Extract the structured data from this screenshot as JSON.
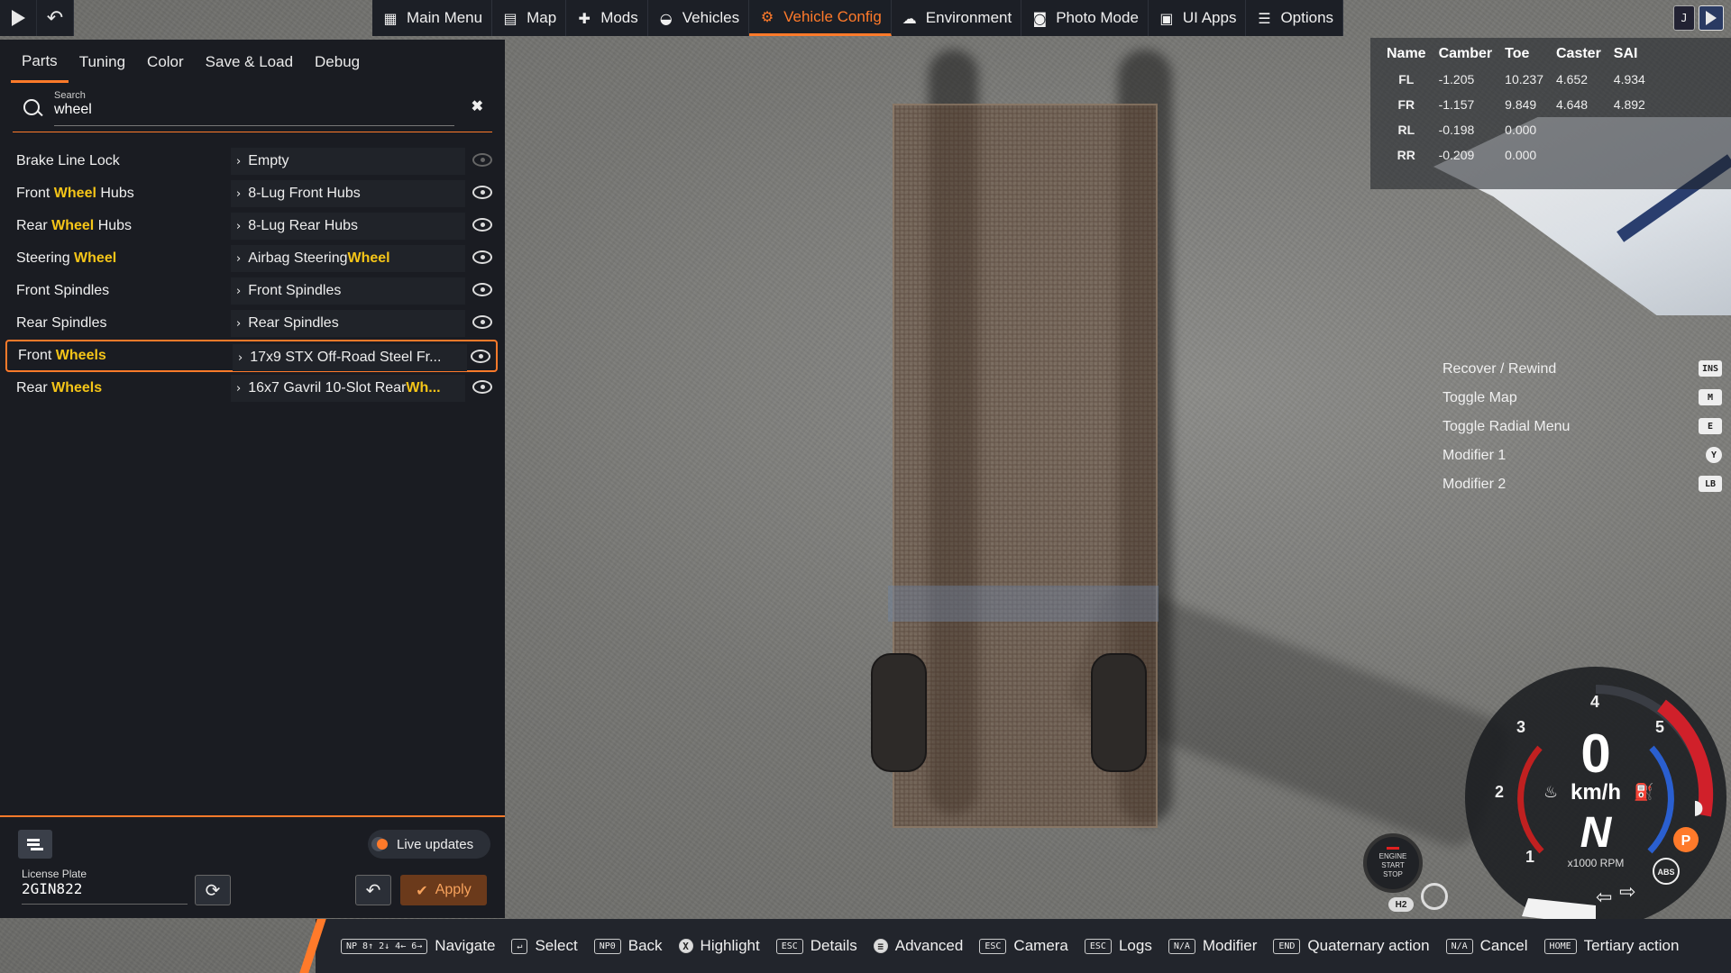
{
  "topbar": {
    "menu": [
      {
        "label": "Main Menu",
        "icon": "main-menu-icon",
        "glyph": "▦",
        "active": false
      },
      {
        "label": "Map",
        "icon": "map-icon",
        "glyph": "▤",
        "active": false
      },
      {
        "label": "Mods",
        "icon": "puzzle-icon",
        "glyph": "✚",
        "active": false
      },
      {
        "label": "Vehicles",
        "icon": "car-icon",
        "glyph": "◒",
        "active": false
      },
      {
        "label": "Vehicle Config",
        "icon": "engine-icon",
        "glyph": "⚙",
        "active": true
      },
      {
        "label": "Environment",
        "icon": "weather-icon",
        "glyph": "☁",
        "active": false
      },
      {
        "label": "Photo Mode",
        "icon": "camera-icon",
        "glyph": "◙",
        "active": false
      },
      {
        "label": "UI Apps",
        "icon": "apps-icon",
        "glyph": "▣",
        "active": false
      },
      {
        "label": "Options",
        "icon": "sliders-icon",
        "glyph": "☰",
        "active": false
      }
    ],
    "right_key": "J"
  },
  "panel": {
    "tabs": [
      "Parts",
      "Tuning",
      "Color",
      "Save & Load",
      "Debug"
    ],
    "active_tab": "Parts",
    "search": {
      "label": "Search",
      "value": "wheel"
    },
    "parts": [
      {
        "pre": "Brake Line Lock",
        "hl": "",
        "post": "",
        "value_pre": "Empty",
        "value_hl": "",
        "value_post": "",
        "visible": false,
        "selected": false
      },
      {
        "pre": "Front ",
        "hl": "Wheel",
        "post": " Hubs",
        "value_pre": "8-Lug Front Hubs",
        "value_hl": "",
        "value_post": "",
        "visible": true,
        "selected": false
      },
      {
        "pre": "Rear ",
        "hl": "Wheel",
        "post": " Hubs",
        "value_pre": "8-Lug Rear Hubs",
        "value_hl": "",
        "value_post": "",
        "visible": true,
        "selected": false
      },
      {
        "pre": "Steering ",
        "hl": "Wheel",
        "post": "",
        "value_pre": "Airbag Steering ",
        "value_hl": "Wheel",
        "value_post": "",
        "visible": true,
        "selected": false
      },
      {
        "pre": "Front Spindles",
        "hl": "",
        "post": "",
        "value_pre": "Front Spindles",
        "value_hl": "",
        "value_post": "",
        "visible": true,
        "selected": false
      },
      {
        "pre": "Rear Spindles",
        "hl": "",
        "post": "",
        "value_pre": "Rear Spindles",
        "value_hl": "",
        "value_post": "",
        "visible": true,
        "selected": false
      },
      {
        "pre": "Front ",
        "hl": "Wheels",
        "post": "",
        "value_pre": "17x9 STX Off-Road Steel Fr...",
        "value_hl": "",
        "value_post": "",
        "visible": true,
        "selected": true
      },
      {
        "pre": "Rear ",
        "hl": "Wheels",
        "post": "",
        "value_pre": "16x7 Gavril 10-Slot Rear ",
        "value_hl": "Wh...",
        "value_post": "",
        "visible": true,
        "selected": false
      }
    ],
    "bottom": {
      "live_updates": "Live updates",
      "plate_label": "License Plate",
      "plate_value": "2GIN822",
      "apply": "Apply"
    }
  },
  "alignment": {
    "headers": [
      "Name",
      "Camber",
      "Toe",
      "Caster",
      "SAI"
    ],
    "rows": [
      [
        "FL",
        "-1.205",
        "10.237",
        "4.652",
        "4.934"
      ],
      [
        "FR",
        "-1.157",
        "9.849",
        "4.648",
        "4.892"
      ],
      [
        "RL",
        "-0.198",
        "0.000",
        "",
        ""
      ],
      [
        "RR",
        "-0.209",
        "0.000",
        "",
        ""
      ]
    ]
  },
  "hints": [
    {
      "label": "Recover / Rewind",
      "key": "INS",
      "round": false
    },
    {
      "label": "Toggle Map",
      "key": "M",
      "round": false
    },
    {
      "label": "Toggle Radial Menu",
      "key": "E",
      "round": false
    },
    {
      "label": "Modifier 1",
      "key": "Y",
      "round": true
    },
    {
      "label": "Modifier 2",
      "key": "LB",
      "round": false
    }
  ],
  "bottombar": [
    {
      "key": "NP 8↑ 2↓ 4← 6→",
      "label": "Navigate",
      "circ": false
    },
    {
      "key": "↵",
      "label": "Select",
      "circ": false
    },
    {
      "key": "NP0",
      "label": "Back",
      "circ": false
    },
    {
      "key": "X",
      "label": "Highlight",
      "circ": true
    },
    {
      "key": "ESC",
      "label": "Details",
      "circ": false
    },
    {
      "key": "≡",
      "label": "Advanced",
      "circ": true
    },
    {
      "key": "ESC",
      "label": "Camera",
      "circ": false
    },
    {
      "key": "ESC",
      "label": "Logs",
      "circ": false
    },
    {
      "key": "N/A",
      "label": "Modifier",
      "circ": false
    },
    {
      "key": "END",
      "label": "Quaternary action",
      "circ": false
    },
    {
      "key": "N/A",
      "label": "Cancel",
      "circ": false
    },
    {
      "key": "HOME",
      "label": "Tertiary action",
      "circ": false
    }
  ],
  "gauge": {
    "speed": "0",
    "unit": "km/h",
    "gear": "N",
    "rpm_label": "x1000 RPM",
    "ticks": [
      "1",
      "2",
      "3",
      "4",
      "5"
    ],
    "engine_btn": [
      "ENGINE",
      "START",
      "STOP"
    ],
    "h2": "H2",
    "park": "P",
    "abs": "ABS",
    "colors": {
      "redline": "#d0202a",
      "blue": "#2a5fd0"
    }
  }
}
